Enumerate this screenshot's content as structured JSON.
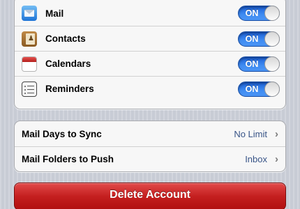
{
  "accounts_sync": {
    "items": [
      {
        "label": "Mail",
        "icon": "mail-icon",
        "toggle": "ON"
      },
      {
        "label": "Contacts",
        "icon": "contacts-icon",
        "toggle": "ON"
      },
      {
        "label": "Calendars",
        "icon": "calendar-icon",
        "toggle": "ON"
      },
      {
        "label": "Reminders",
        "icon": "reminders-icon",
        "toggle": "ON"
      }
    ]
  },
  "mail_settings": {
    "items": [
      {
        "label": "Mail Days to Sync",
        "value": "No Limit"
      },
      {
        "label": "Mail Folders to Push",
        "value": "Inbox"
      }
    ],
    "chevron": "›"
  },
  "delete_account": {
    "label": "Delete Account"
  },
  "colors": {
    "toggle_on": "#3f8cf2",
    "value_text": "#385487",
    "delete_button": "#c41f1f",
    "background": "#c8ccd5"
  }
}
